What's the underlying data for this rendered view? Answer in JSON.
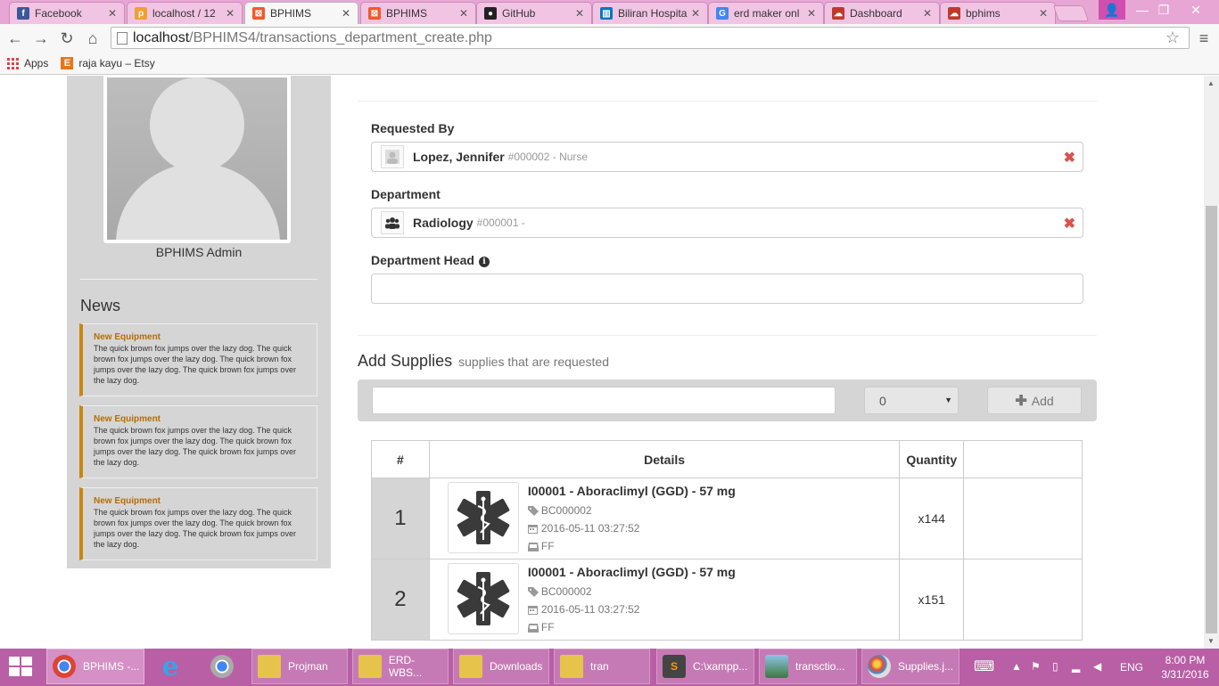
{
  "browser": {
    "tabs": [
      {
        "title": "Facebook",
        "icon": "facebook-icon",
        "color": "#3b5998"
      },
      {
        "title": "localhost / 12",
        "icon": "phpmyadmin-icon",
        "color": "#f0a030"
      },
      {
        "title": "BPHIMS",
        "icon": "xampp-icon",
        "color": "#f1592a",
        "active": true
      },
      {
        "title": "BPHIMS",
        "icon": "xampp-icon",
        "color": "#f1592a"
      },
      {
        "title": "GitHub",
        "icon": "github-icon",
        "color": "#222222"
      },
      {
        "title": "Biliran Hospita",
        "icon": "trello-icon",
        "color": "#0079bf"
      },
      {
        "title": "erd maker onl",
        "icon": "google-icon",
        "color": "#4285f4"
      },
      {
        "title": "Dashboard",
        "icon": "cloud-icon",
        "color": "#c0392b"
      },
      {
        "title": "bphims",
        "icon": "cloud-icon",
        "color": "#c0392b"
      }
    ],
    "url_host": "localhost",
    "url_path": "/BPHIMS4/transactions_department_create.php",
    "bookmarks": [
      {
        "label": "Apps"
      },
      {
        "label": "raja kayu – Etsy"
      }
    ]
  },
  "sidebar": {
    "admin_name": "BPHIMS Admin",
    "news_title": "News",
    "news": [
      {
        "title": "New Equipment",
        "body": "The quick brown fox jumps over the lazy dog. The quick brown fox jumps over the lazy dog. The quick brown fox jumps over the lazy dog. The quick brown fox jumps over the lazy dog."
      },
      {
        "title": "New Equipment",
        "body": "The quick brown fox jumps over the lazy dog. The quick brown fox jumps over the lazy dog. The quick brown fox jumps over the lazy dog. The quick brown fox jumps over the lazy dog."
      },
      {
        "title": "New Equipment",
        "body": "The quick brown fox jumps over the lazy dog. The quick brown fox jumps over the lazy dog. The quick brown fox jumps over the lazy dog. The quick brown fox jumps over the lazy dog."
      }
    ]
  },
  "form": {
    "requested_by_label": "Requested By",
    "requested_by": {
      "name": "Lopez, Jennifer",
      "sub": "#000002 - Nurse"
    },
    "department_label": "Department",
    "department": {
      "name": "Radiology",
      "sub": "#000001 -"
    },
    "department_head_label": "Department Head",
    "department_head_value": "",
    "add_supplies_title": "Add Supplies",
    "add_supplies_subtitle": "supplies that are requested",
    "supply_search_value": "",
    "quantity_value": "0",
    "add_button_label": "Add"
  },
  "table": {
    "headers": [
      "#",
      "Details",
      "Quantity",
      ""
    ],
    "rows": [
      {
        "num": "1",
        "title": "I00001 - Aboraclimyl (GGD) - 57 mg",
        "barcode": "BC000002",
        "date": "2016-05-11 03:27:52",
        "unit": "FF",
        "qty": "x144"
      },
      {
        "num": "2",
        "title": "I00001 - Aboraclimyl (GGD) - 57 mg",
        "barcode": "BC000002",
        "date": "2016-05-11 03:27:52",
        "unit": "FF",
        "qty": "x151"
      }
    ]
  },
  "taskbar": {
    "items": [
      {
        "label": "BPHIMS -...",
        "icon": "chrome-icon"
      },
      {
        "label": "",
        "icon": "internet-explorer-icon"
      },
      {
        "label": "",
        "icon": "chrome-icon"
      },
      {
        "label": "Projman",
        "icon": "folder-icon"
      },
      {
        "label": "ERD-WBS...",
        "icon": "folder-icon"
      },
      {
        "label": "Downloads",
        "icon": "folder-icon"
      },
      {
        "label": "tran",
        "icon": "folder-icon"
      },
      {
        "label": "C:\\xampp...",
        "icon": "sublime-icon"
      },
      {
        "label": "transctio...",
        "icon": "image-icon"
      },
      {
        "label": "Supplies.j...",
        "icon": "paint-icon"
      }
    ],
    "language": "ENG",
    "time": "8:00 PM",
    "date": "3/31/2016"
  }
}
